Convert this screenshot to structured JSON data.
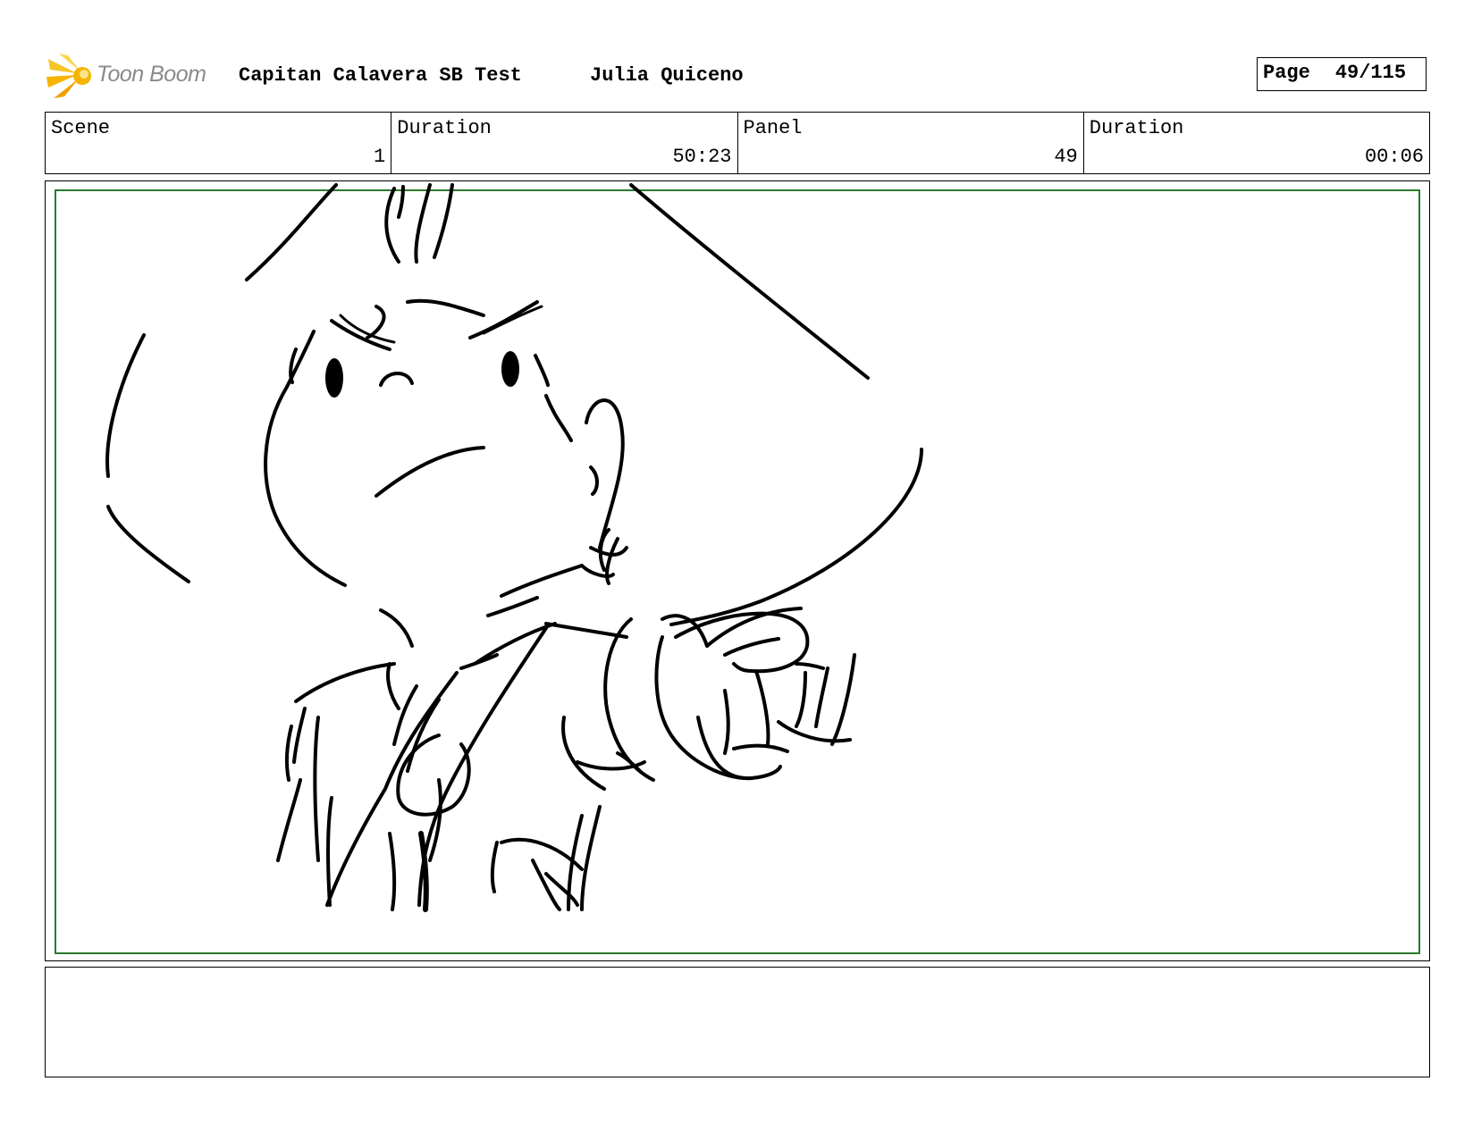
{
  "header": {
    "logo_text": "Toon Boom",
    "project_title": "Capitan Calavera SB Test",
    "author": "Julia Quiceno",
    "page_label": "Page",
    "page_number": "49/115"
  },
  "info": {
    "scene_label": "Scene",
    "scene_value": "1",
    "scene_duration_label": "Duration",
    "scene_duration_value": "50:23",
    "panel_label": "Panel",
    "panel_value": "49",
    "panel_duration_label": "Duration",
    "panel_duration_value": "00:06"
  },
  "colors": {
    "safe_area_border": "#2a7a2a",
    "logo_flame": "#f5b400",
    "logo_text": "#8a8a8a"
  },
  "notes": {
    "text": ""
  }
}
